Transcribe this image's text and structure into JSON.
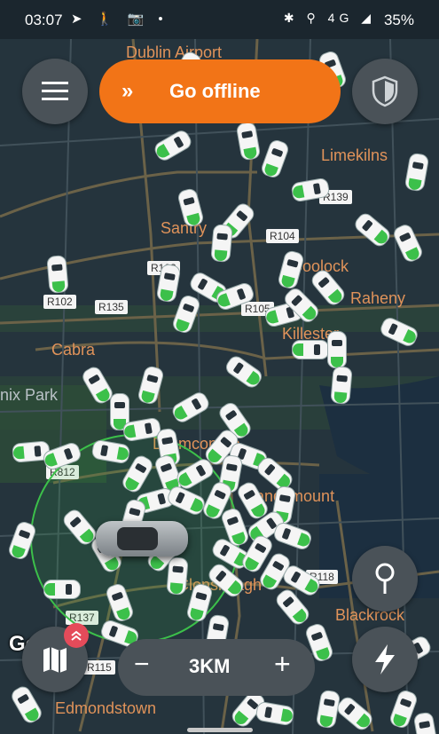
{
  "status_bar": {
    "time": "03:07",
    "left_icons": "➤ 🚶 📷 •",
    "right_icons": "✱ ⚲ 4G ◢",
    "battery": "35%"
  },
  "top_bar": {
    "menu_icon": "hamburger-icon",
    "go_offline_label": "Go offline",
    "go_offline_chevron": "»",
    "shield_icon": "shield-icon"
  },
  "map": {
    "places": [
      {
        "text": "Dublin Airport",
        "kind": "place"
      },
      {
        "text": "Limekilns",
        "kind": "place"
      },
      {
        "text": "Santry",
        "kind": "place"
      },
      {
        "text": "Coolock",
        "kind": "place"
      },
      {
        "text": "Raheny",
        "kind": "place"
      },
      {
        "text": "Killester",
        "kind": "place"
      },
      {
        "text": "Cabra",
        "kind": "place"
      },
      {
        "text": "nix Park",
        "kind": "park"
      },
      {
        "text": "Drumcondra",
        "kind": "place"
      },
      {
        "text": "Sandymount",
        "kind": "place"
      },
      {
        "text": "Clonskeagh",
        "kind": "place"
      },
      {
        "text": "Blackrock",
        "kind": "place"
      },
      {
        "text": "Edmondstown",
        "kind": "place"
      }
    ],
    "roads": [
      "R139",
      "R104",
      "R103",
      "R102",
      "R135",
      "R105",
      "R812",
      "R118",
      "R137",
      "R115"
    ],
    "google_attribution": "Google",
    "badge_count": ""
  },
  "controls": {
    "zoom_minus": "−",
    "zoom_value": "3KM",
    "zoom_plus": "+",
    "map_icon": "map-icon",
    "pin_icon": "pin-icon",
    "lightning_icon": "lightning-icon"
  },
  "colors": {
    "accent": "#f27417",
    "car_green": "#3cc04a",
    "map_bg": "#25343d",
    "label_orange": "#e0935a"
  }
}
